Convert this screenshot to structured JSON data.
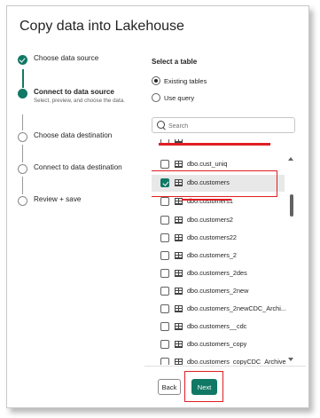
{
  "dialog": {
    "title": "Copy data into Lakehouse"
  },
  "steps": [
    {
      "label": "Choose data source",
      "status": "done"
    },
    {
      "label": "Connect to data source",
      "sub": "Select, preview, and choose the data.",
      "status": "current"
    },
    {
      "label": "Choose data destination",
      "status": "pending"
    },
    {
      "label": "Connect to data destination",
      "status": "pending"
    },
    {
      "label": "Review + save",
      "status": "pending"
    }
  ],
  "pane": {
    "title": "Select a table",
    "radios": [
      {
        "label": "Existing tables",
        "selected": true
      },
      {
        "label": "Use query",
        "selected": false
      }
    ],
    "search": {
      "placeholder": "Search",
      "value": ""
    }
  },
  "tables": [
    {
      "name": "dbo.cust_uniq",
      "checked": false
    },
    {
      "name": "dbo.customers",
      "checked": true
    },
    {
      "name": "dbo.customers1",
      "checked": false
    },
    {
      "name": "dbo.customers2",
      "checked": false
    },
    {
      "name": "dbo.customers22",
      "checked": false
    },
    {
      "name": "dbo.customers_2",
      "checked": false
    },
    {
      "name": "dbo.customers_2des",
      "checked": false
    },
    {
      "name": "dbo.customers_2new",
      "checked": false
    },
    {
      "name": "dbo.customers_2newCDC_Archi...",
      "checked": false
    },
    {
      "name": "dbo.customers__cdc",
      "checked": false
    },
    {
      "name": "dbo.customers_copy",
      "checked": false
    },
    {
      "name": "dbo.customers_copyCDC_Archive",
      "checked": false
    }
  ],
  "footer": {
    "back_label": "Back",
    "next_label": "Next"
  },
  "colors": {
    "accent": "#117865",
    "annotation": "#e01e22"
  }
}
